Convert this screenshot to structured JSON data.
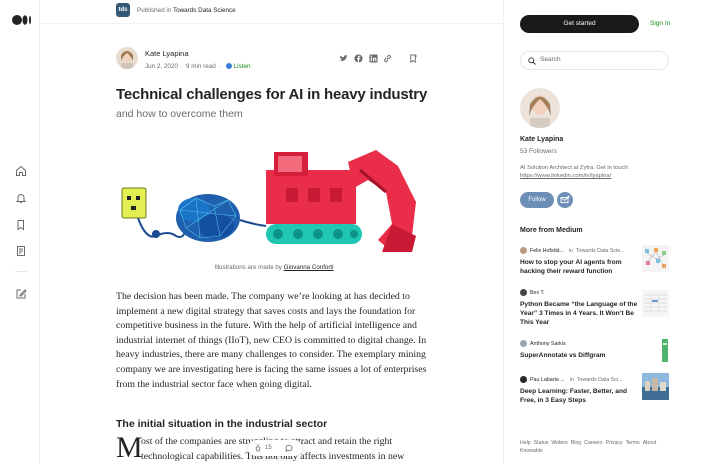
{
  "nav": {
    "icons": [
      "medium-logo-icon",
      "home-icon",
      "bell-icon",
      "bookmarks-icon",
      "stories-icon",
      "write-icon"
    ]
  },
  "publication": {
    "badge": "tds",
    "prefix": "Published in",
    "name": "Towards Data Science"
  },
  "article": {
    "author": "Kate Lyapina",
    "date": "Jun 2, 2020",
    "read_time": "9 min read",
    "listen_label": "Listen",
    "title": "Technical challenges for AI in heavy industry",
    "subtitle": "and how to overcome them",
    "caption_prefix": "Illustrations are made by",
    "caption_author": "Giovanna Conforti",
    "paragraph1": "The decision has been made. The company we’re looking at has decided to implement a new digital strategy that saves costs and lays the foundation for competitive business in the future. With the help of artificial intelligence and industrial internet of things (IIoT), new CEO is committed to digital change. In heavy industries, there are many challenges to consider. The exemplary mining company we are investigating here is facing the same issues a lot of enterprises from the industrial sector face when going digital.",
    "heading2": "The initial situation in the industrial sector",
    "dropcap": "M",
    "paragraph2": "ost of the companies are struggling to attract and retain the right technological capabilities. This not only affects investments in new",
    "clap_count": "15"
  },
  "sidebar": {
    "get_started": "Get started",
    "sign_in": "Sign In",
    "search_placeholder": "Search",
    "author_name": "Kate Lyapina",
    "followers": "53 Followers",
    "bio": "AI Solution Architect at Zyfra. Get in touch:",
    "bio_link": "https://www.linkedin.com/in/lyapina/",
    "follow": "Follow",
    "more_heading": "More from Medium",
    "stories": [
      {
        "author": "Felix Hofstät...",
        "in": "in",
        "pub": "Towards Data Scie...",
        "title": "How to stop your AI agents from hacking their reward function"
      },
      {
        "author": "Bex T.",
        "in": "",
        "pub": "",
        "title": "Python Became “the Language of the Year” 3 Times in 4 Years. It Won’t Be This Year"
      },
      {
        "author": "Anthony Sarkis",
        "in": "",
        "pub": "",
        "title": "SuperAnnotate vs Diffgram"
      },
      {
        "author": "Pau Labarta ...",
        "in": "in",
        "pub": "Towards Data Sci...",
        "title": "Deep Learning: Faster, Better, and Free, in 3 Easy Steps"
      }
    ],
    "footer": [
      "Help",
      "Status",
      "Writers",
      "Blog",
      "Careers",
      "Privacy",
      "Terms",
      "About",
      "Knowable"
    ]
  },
  "colors": {
    "accent_green": "#1a8917",
    "follow_blue": "#6d8fb7",
    "dark_button": "#191919"
  }
}
